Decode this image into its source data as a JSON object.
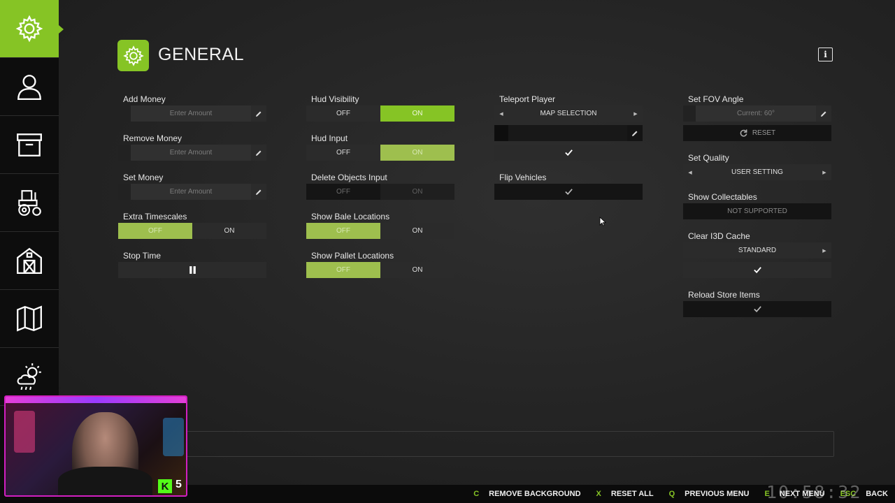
{
  "header": {
    "title": "GENERAL",
    "info_label": "i"
  },
  "sidebar": {
    "items": [
      {
        "icon": "gear-icon",
        "active": true
      },
      {
        "icon": "person-icon",
        "active": false
      },
      {
        "icon": "storage-box-icon",
        "active": false
      },
      {
        "icon": "tractor-icon",
        "active": false
      },
      {
        "icon": "barn-icon",
        "active": false
      },
      {
        "icon": "map-icon",
        "active": false
      },
      {
        "icon": "weather-icon",
        "active": false
      }
    ]
  },
  "col1": {
    "add_money": {
      "label": "Add Money",
      "placeholder": "Enter Amount"
    },
    "remove_money": {
      "label": "Remove Money",
      "placeholder": "Enter Amount"
    },
    "set_money": {
      "label": "Set Money",
      "placeholder": "Enter Amount"
    },
    "extra_timescales": {
      "label": "Extra Timescales",
      "off": "OFF",
      "on": "ON",
      "selected": "OFF"
    },
    "stop_time": {
      "label": "Stop Time",
      "icon": "pause-icon"
    }
  },
  "col2": {
    "hud_visibility": {
      "label": "Hud Visibility",
      "off": "OFF",
      "on": "ON",
      "selected": "ON"
    },
    "hud_input": {
      "label": "Hud Input",
      "off": "OFF",
      "on": "ON",
      "selected": "ON"
    },
    "delete_objects_input": {
      "label": "Delete Objects Input",
      "off": "OFF",
      "on": "ON",
      "selected": "OFF"
    },
    "show_bale_locations": {
      "label": "Show Bale Locations",
      "off": "OFF",
      "on": "ON",
      "selected": "OFF"
    },
    "show_pallet_locations": {
      "label": "Show Pallet Locations",
      "off": "OFF",
      "on": "ON",
      "selected": "OFF"
    }
  },
  "col3": {
    "teleport_player": {
      "label": "Teleport Player",
      "selection": "MAP SELECTION"
    },
    "flip_vehicles": {
      "label": "Flip Vehicles"
    }
  },
  "col4": {
    "set_fov_angle": {
      "label": "Set FOV Angle",
      "placeholder": "Current: 60°",
      "reset_label": "RESET"
    },
    "set_quality": {
      "label": "Set Quality",
      "selection": "USER SETTING"
    },
    "show_collectables": {
      "label": "Show Collectables",
      "value": "NOT SUPPORTED"
    },
    "clear_i3d_cache": {
      "label": "Clear I3D Cache",
      "selection": "STANDARD"
    },
    "reload_store_items": {
      "label": "Reload Store Items"
    }
  },
  "footer": {
    "actions": [
      {
        "key": "C",
        "label": "REMOVE BACKGROUND"
      },
      {
        "key": "X",
        "label": "RESET ALL"
      },
      {
        "key": "Q",
        "label": "PREVIOUS MENU"
      },
      {
        "key": "E",
        "label": "NEXT MENU"
      },
      {
        "key": "ESC",
        "label": "BACK"
      }
    ],
    "clock": "10:58:32"
  },
  "webcam": {
    "badge": "K",
    "count": "5"
  },
  "colors": {
    "accent": "#86c425",
    "accent_muted": "#9ebf4e",
    "panel": "#2b2b2b",
    "sidebar": "#0d0d0d"
  }
}
